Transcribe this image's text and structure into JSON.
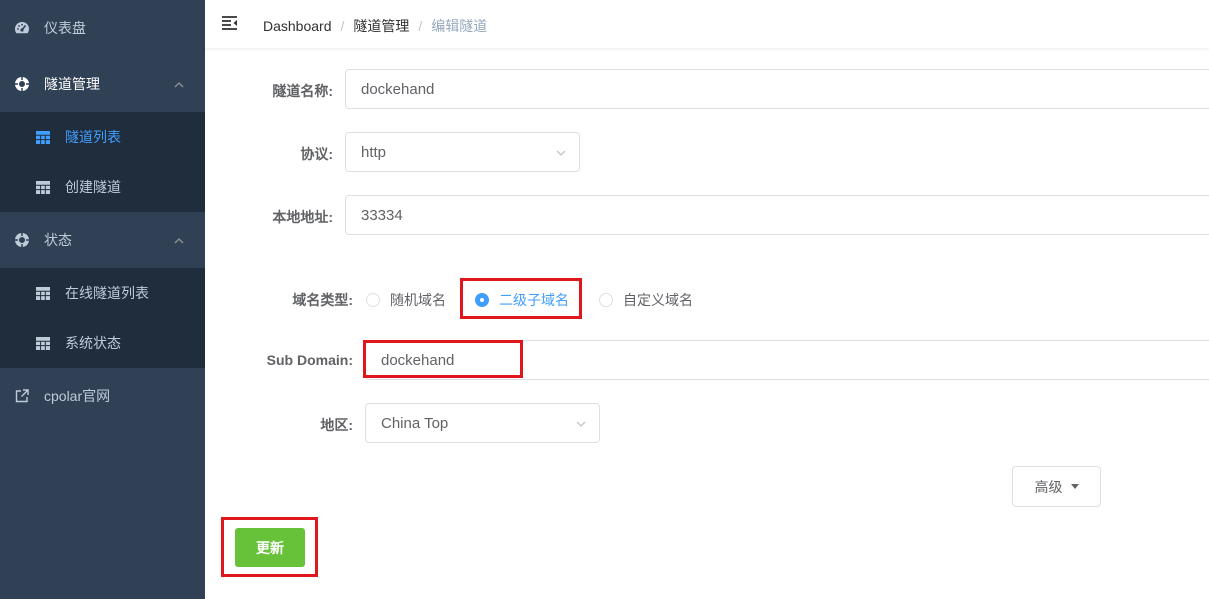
{
  "sidebar": {
    "dashboard": "仪表盘",
    "tunnel_mgmt": "隧道管理",
    "tunnel_list": "隧道列表",
    "create_tunnel": "创建隧道",
    "status": "状态",
    "online_tunnels": "在线隧道列表",
    "system_status": "系统状态",
    "cpolar_site": "cpolar官网"
  },
  "breadcrumb": {
    "home": "Dashboard",
    "sep1": "/",
    "section": "隧道管理",
    "sep2": "/",
    "current": "编辑隧道"
  },
  "form": {
    "name_label": "隧道名称:",
    "name_value": "dockehand",
    "protocol_label": "协议:",
    "protocol_value": "http",
    "local_label": "本地地址:",
    "local_value": "33334",
    "domain_type_label": "域名类型:",
    "domain_options": [
      "随机域名",
      "二级子域名",
      "自定义域名"
    ],
    "domain_selected": "二级子域名",
    "subdomain_label": "Sub Domain:",
    "subdomain_value": "dockehand",
    "region_label": "地区:",
    "region_value": "China Top"
  },
  "buttons": {
    "advanced": "高级",
    "update": "更新"
  },
  "colors": {
    "sidebar_bg": "#304156",
    "submenu_bg": "#1f2d3d",
    "accent": "#409eff",
    "update_green": "#67c23a",
    "highlight_red": "#e0161d"
  }
}
